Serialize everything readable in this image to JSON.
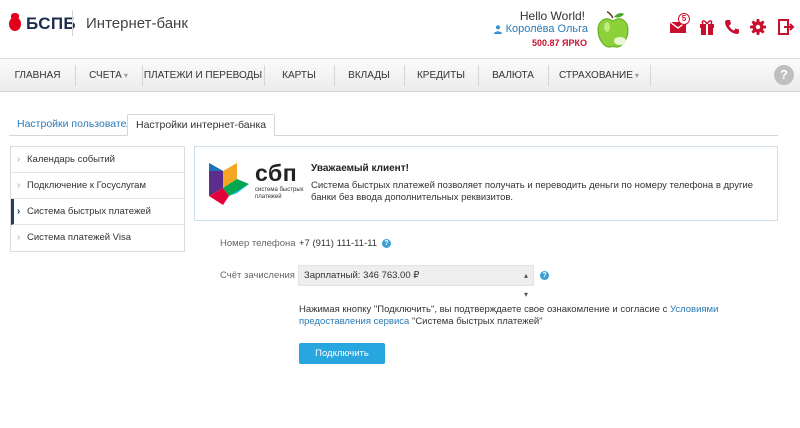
{
  "header": {
    "logo_text": "БСПБ",
    "app_title": "Интернет-банк",
    "greeting": "Hello World!",
    "user_name": "Королёва Ольга",
    "points": "500.87 ЯРКО",
    "mail_count": "5",
    "icons": [
      "mail-icon",
      "gift-icon",
      "phone-icon",
      "gear-icon",
      "logout-icon"
    ],
    "accent_color": "#c8102e"
  },
  "nav": {
    "items": [
      {
        "label": "Главная",
        "dropdown": false
      },
      {
        "label": "Счета",
        "dropdown": true
      },
      {
        "label": "Платежи и переводы",
        "dropdown": false
      },
      {
        "label": "Карты",
        "dropdown": false
      },
      {
        "label": "Вклады",
        "dropdown": false
      },
      {
        "label": "Кредиты",
        "dropdown": false
      },
      {
        "label": "Валюта",
        "dropdown": false
      },
      {
        "label": "Страхование",
        "dropdown": true
      }
    ],
    "help_label": "?"
  },
  "tabs": [
    {
      "label": "Настройки пользователя",
      "active": false
    },
    {
      "label": "Настройки интернет-банка",
      "active": true
    }
  ],
  "sidebar": {
    "items": [
      {
        "label": "Календарь событий",
        "active": false
      },
      {
        "label": "Подключение к Госуслугам",
        "active": false
      },
      {
        "label": "Система быстрых платежей",
        "active": true
      },
      {
        "label": "Система платежей Visa",
        "active": false
      }
    ]
  },
  "sbp_card": {
    "logo_word": "сбп",
    "logo_subtitle": "система быстрых платежей",
    "title": "Уважаемый клиент!",
    "text": "Система быстрых платежей позволяет получать и переводить деньги по номеру телефона в другие банки без ввода дополнительных реквизитов."
  },
  "form": {
    "phone_label": "Номер телефона",
    "phone_value": "+7 (911) 111-11-11",
    "account_label": "Счёт зачисления",
    "account_value": "Зарплатный: 346 763.00 ₽",
    "consent_prefix": "Нажимая кнопку \"Подключить\", вы подтверждаете свое ознакомление и согласие с ",
    "consent_link": "Условиями предоставления сервиса",
    "consent_suffix": " \"Система быстрых платежей\"",
    "connect_button": "Подключить"
  }
}
